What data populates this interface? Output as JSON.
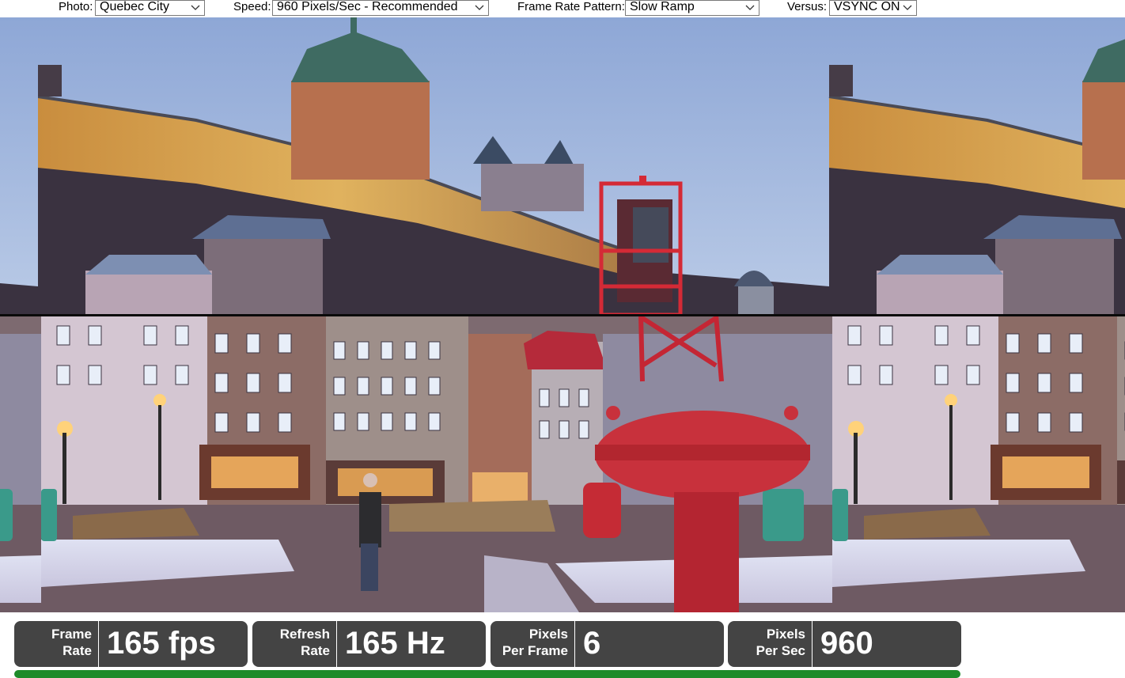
{
  "controls": {
    "photo": {
      "label": "Photo:",
      "value": "Quebec City"
    },
    "speed": {
      "label": "Speed:",
      "value": "960 Pixels/Sec - Recommended"
    },
    "pattern": {
      "label": "Frame Rate Pattern:",
      "value": "Slow Ramp"
    },
    "versus": {
      "label": "Versus:",
      "value": "VSYNC ON"
    }
  },
  "stats": [
    {
      "label_line1": "Frame",
      "label_line2": "Rate",
      "value": "165 fps"
    },
    {
      "label_line1": "Refresh",
      "label_line2": "Rate",
      "value": "165 Hz"
    },
    {
      "label_line1": "Pixels",
      "label_line2": "Per Frame",
      "value": "6"
    },
    {
      "label_line1": "Pixels",
      "label_line2": "Per Sec",
      "value": "960"
    }
  ],
  "icons": {
    "dropdown": "chevron-down-icon"
  },
  "colors": {
    "stat_box": "#444444",
    "progress": "#1e8b2a",
    "divider": "#0a0a0a"
  }
}
